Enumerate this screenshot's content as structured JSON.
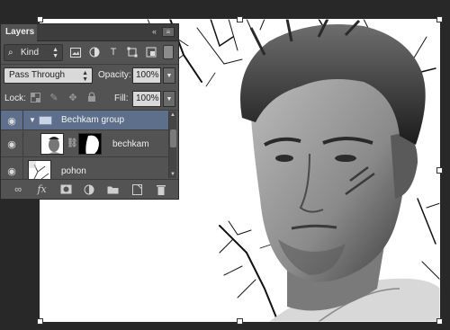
{
  "panel": {
    "tab_label": "Layers",
    "collapse_icon": "double-chevron-left-icon",
    "menu_icon": "panel-menu-icon"
  },
  "filter": {
    "kind_label": "Kind",
    "icons": [
      "image-filter-icon",
      "adjustment-filter-icon",
      "type-filter-icon",
      "shape-filter-icon",
      "smart-object-filter-icon"
    ]
  },
  "blend": {
    "mode": "Pass Through",
    "opacity_label": "Opacity:",
    "opacity_value": "100%"
  },
  "lock": {
    "label": "Lock:",
    "icons": [
      "lock-transparent-icon",
      "lock-image-icon",
      "lock-position-icon",
      "lock-all-icon"
    ],
    "fill_label": "Fill:",
    "fill_value": "100%"
  },
  "layers": [
    {
      "name": "Bechkam group",
      "type": "group",
      "selected": true,
      "visible": true
    },
    {
      "name": "bechkam",
      "type": "layer-with-mask",
      "selected": false,
      "visible": true
    },
    {
      "name": "pohon",
      "type": "layer",
      "selected": false,
      "visible": true
    }
  ],
  "bottom_icons": [
    "link-layers-icon",
    "fx-icon",
    "add-mask-icon",
    "adjustment-layer-icon",
    "new-group-icon",
    "new-layer-icon",
    "trash-icon"
  ],
  "bottom_labels": {
    "fx": "fx"
  },
  "colors": {
    "panel_bg": "#535353",
    "selection": "#5d6f8a",
    "workspace": "#282828"
  }
}
